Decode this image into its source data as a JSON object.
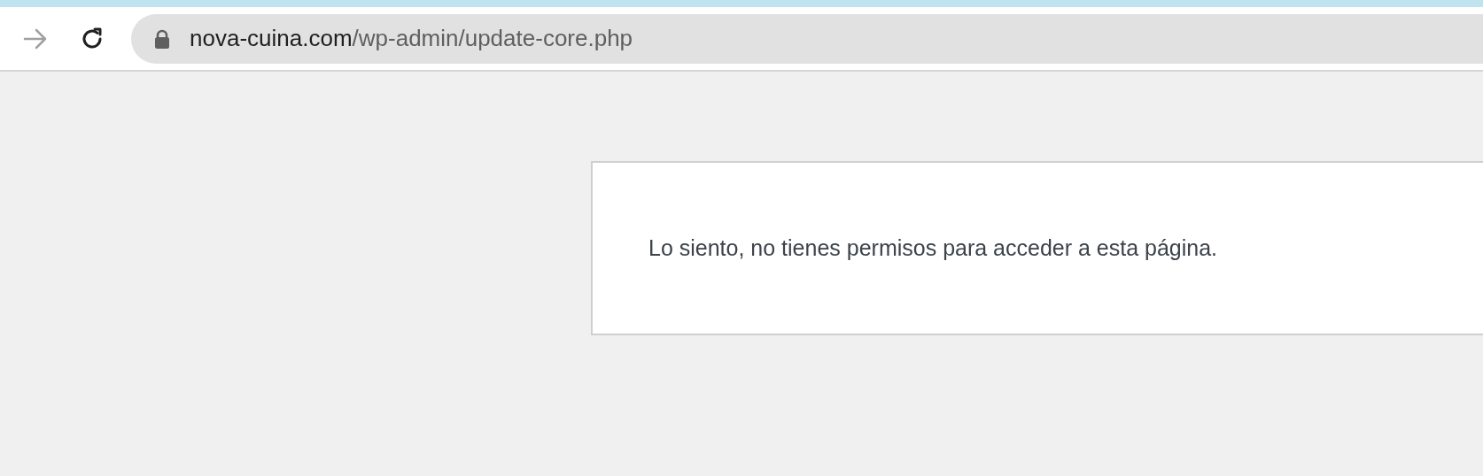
{
  "browser": {
    "forward_disabled": true,
    "secure": true,
    "url_host": "nova-cuina.com",
    "url_path": "/wp-admin/update-core.php"
  },
  "page": {
    "message": "Lo siento, no tienes permisos para acceder a esta página."
  }
}
